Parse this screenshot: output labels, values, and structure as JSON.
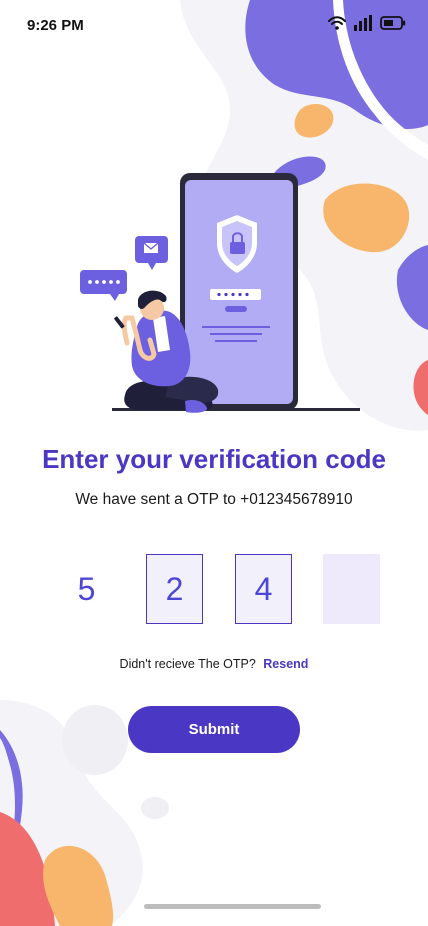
{
  "status_bar": {
    "time": "9:26 PM"
  },
  "page": {
    "title": "Enter your verification code",
    "subtitle": "We have sent a OTP to +012345678910"
  },
  "otp": {
    "digits": [
      "5",
      "2",
      "4",
      ""
    ]
  },
  "resend": {
    "prompt": "Didn't recieve The OTP?",
    "link": "Resend"
  },
  "submit": {
    "label": "Submit"
  },
  "colors": {
    "accent": "#4a37c4",
    "purple_light": "#7b6ee0",
    "orange": "#f7b66b",
    "coral": "#ef6d6d"
  }
}
